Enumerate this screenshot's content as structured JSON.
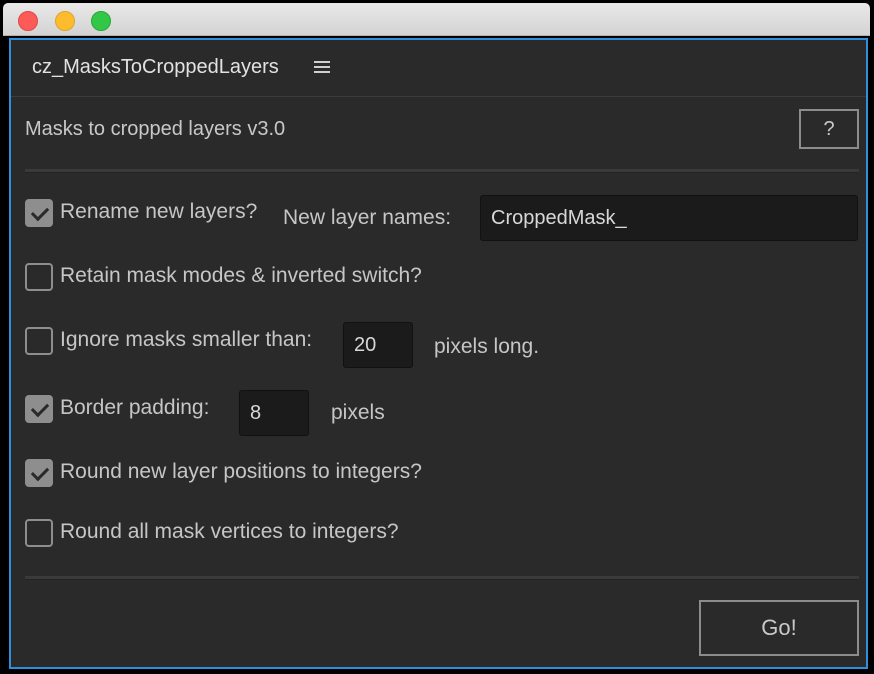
{
  "window": {
    "controls": {
      "close": "#fc5b57",
      "minimize": "#fdbc2e",
      "maximize": "#33c748"
    }
  },
  "panel": {
    "title": "cz_MasksToCroppedLayers",
    "menu_icon": "hamburger-menu-icon",
    "accent": "#2f8fdb"
  },
  "header": {
    "heading": "Masks to cropped layers v3.0",
    "help_label": "?"
  },
  "options": {
    "rename": {
      "label": "Rename new layers?",
      "checked": true
    },
    "names_label": "New layer names:",
    "names_value": "CroppedMask_",
    "retain": {
      "label": "Retain mask modes & inverted switch?",
      "checked": false
    },
    "ignore": {
      "label": "Ignore masks smaller than:",
      "checked": false
    },
    "ignore_value": "20",
    "ignore_suffix": "pixels long.",
    "padding": {
      "label": "Border padding:",
      "checked": true
    },
    "padding_value": "8",
    "padding_suffix": "pixels",
    "round_positions": {
      "label": "Round new layer positions to integers?",
      "checked": true
    },
    "round_vertices": {
      "label": "Round all mask vertices to integers?",
      "checked": false
    }
  },
  "footer": {
    "go_label": "Go!"
  }
}
